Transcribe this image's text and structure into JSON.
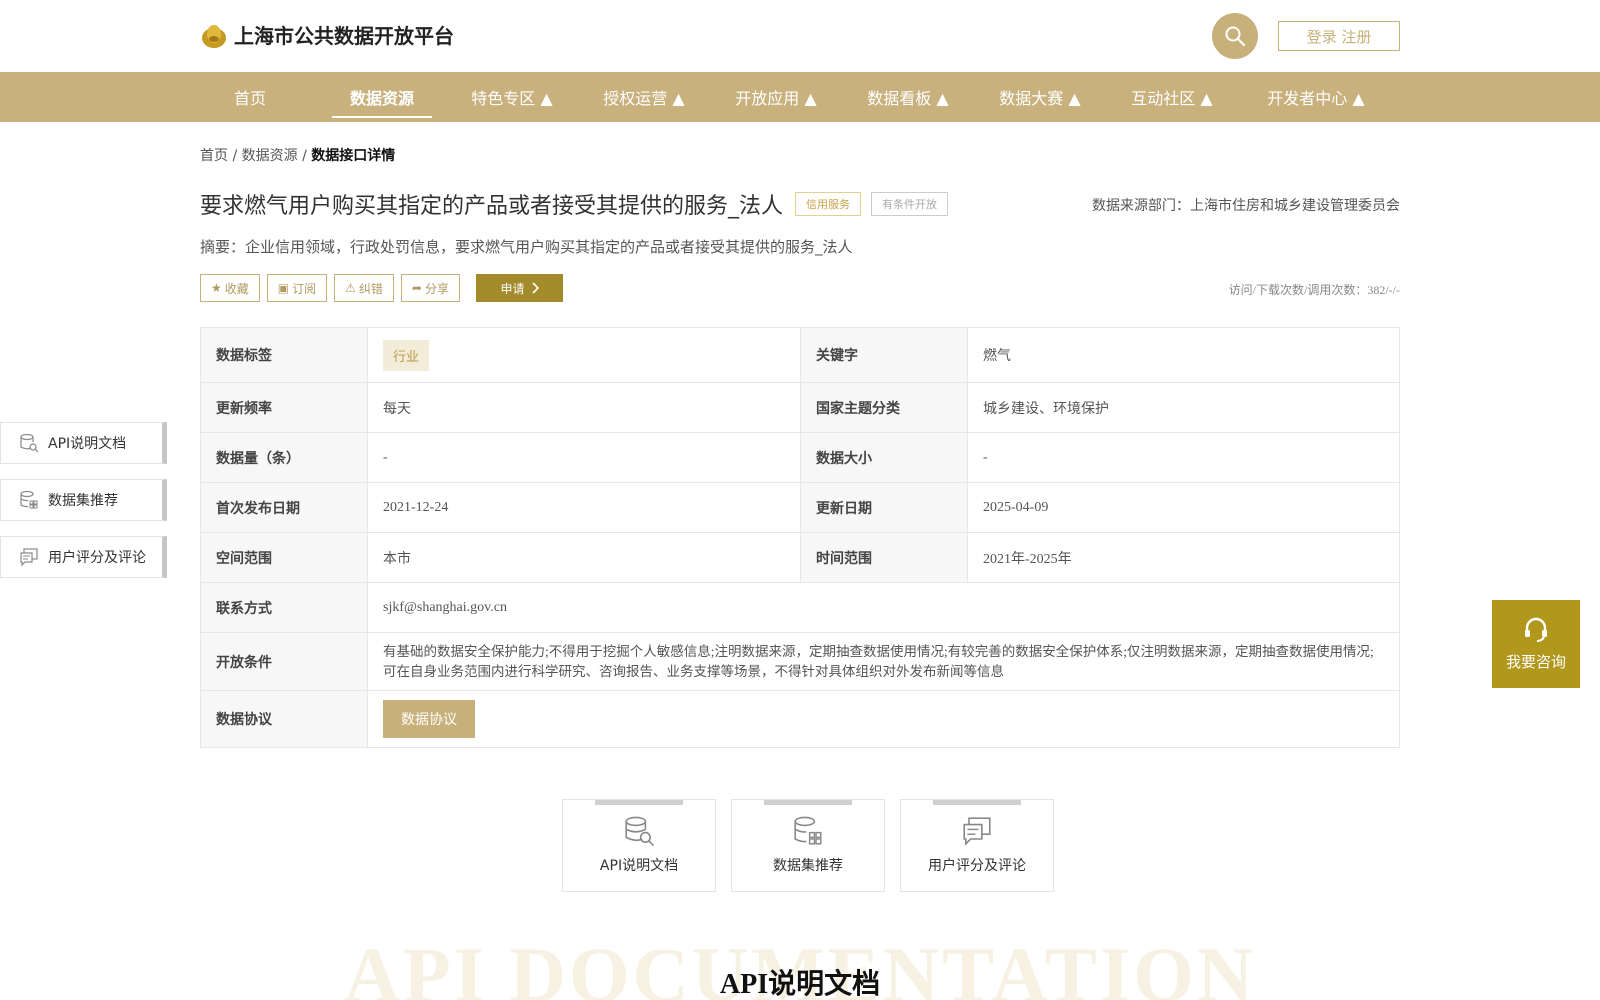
{
  "header": {
    "site_title": "上海市公共数据开放平台",
    "login_label": "登录 注册",
    "brand_color": "#c9b17d"
  },
  "nav": {
    "items": [
      {
        "label": "首页"
      },
      {
        "label": "数据资源",
        "active": true
      },
      {
        "label": "特色专区 ▲"
      },
      {
        "label": "授权运营 ▲"
      },
      {
        "label": "开放应用 ▲"
      },
      {
        "label": "数据看板 ▲"
      },
      {
        "label": "数据大赛 ▲"
      },
      {
        "label": "互动社区 ▲"
      },
      {
        "label": "开发者中心 ▲"
      }
    ]
  },
  "breadcrumb": {
    "home": "首页",
    "sep": "/",
    "resources": "数据资源",
    "current": "数据接口详情"
  },
  "dataset": {
    "title": "要求燃气用户购买其指定的产品或者接受其提供的服务_法人",
    "tag_credit": "信用服务",
    "tag_open": "有条件开放",
    "source": "数据来源部门：上海市住房和城乡建设管理委员会",
    "summary": "摘要：企业信用领域，行政处罚信息，要求燃气用户购买其指定的产品或者接受其提供的服务_法人",
    "stats": "访问/下载次数/调用次数：382/-/-"
  },
  "actions": {
    "favorite": "收藏",
    "subscribe": "订阅",
    "report": "纠错",
    "share": "分享",
    "apply": "申请"
  },
  "info": {
    "tag_label": "数据标签",
    "tag_value": "行业",
    "keyword_label": "关键字",
    "keyword_value": "燃气",
    "freq_label": "更新频率",
    "freq_value": "每天",
    "theme_label": "国家主题分类",
    "theme_value": "城乡建设、环境保护",
    "count_label": "数据量（条）",
    "count_value": "-",
    "size_label": "数据大小",
    "size_value": "-",
    "first_pub_label": "首次发布日期",
    "first_pub_value": "2021-12-24",
    "update_label": "更新日期",
    "update_value": "2025-04-09",
    "space_label": "空间范围",
    "space_value": "本市",
    "time_label": "时间范围",
    "time_value": "2021年-2025年",
    "contact_label": "联系方式",
    "contact_value": "sjkf@shanghai.gov.cn",
    "condition_label": "开放条件",
    "condition_value": "有基础的数据安全保护能力;不得用于挖掘个人敏感信息;注明数据来源，定期抽查数据使用情况;有较完善的数据安全保护体系;仅注明数据来源，定期抽查数据使用情况;可在自身业务范围内进行科学研究、咨询报告、业务支撑等场景，不得针对具体组织对外发布新闻等信息",
    "protocol_label": "数据协议",
    "protocol_button": "数据协议"
  },
  "side_menu": {
    "api_doc": "API说明文档",
    "recommend": "数据集推荐",
    "rating": "用户评分及评论"
  },
  "consult": {
    "label": "我要咨询"
  },
  "cards": {
    "api_doc": "API说明文档",
    "recommend": "数据集推荐",
    "rating": "用户评分及评论"
  },
  "section": {
    "watermark": "API DOCUMENTATION",
    "title": "API说明文档"
  }
}
